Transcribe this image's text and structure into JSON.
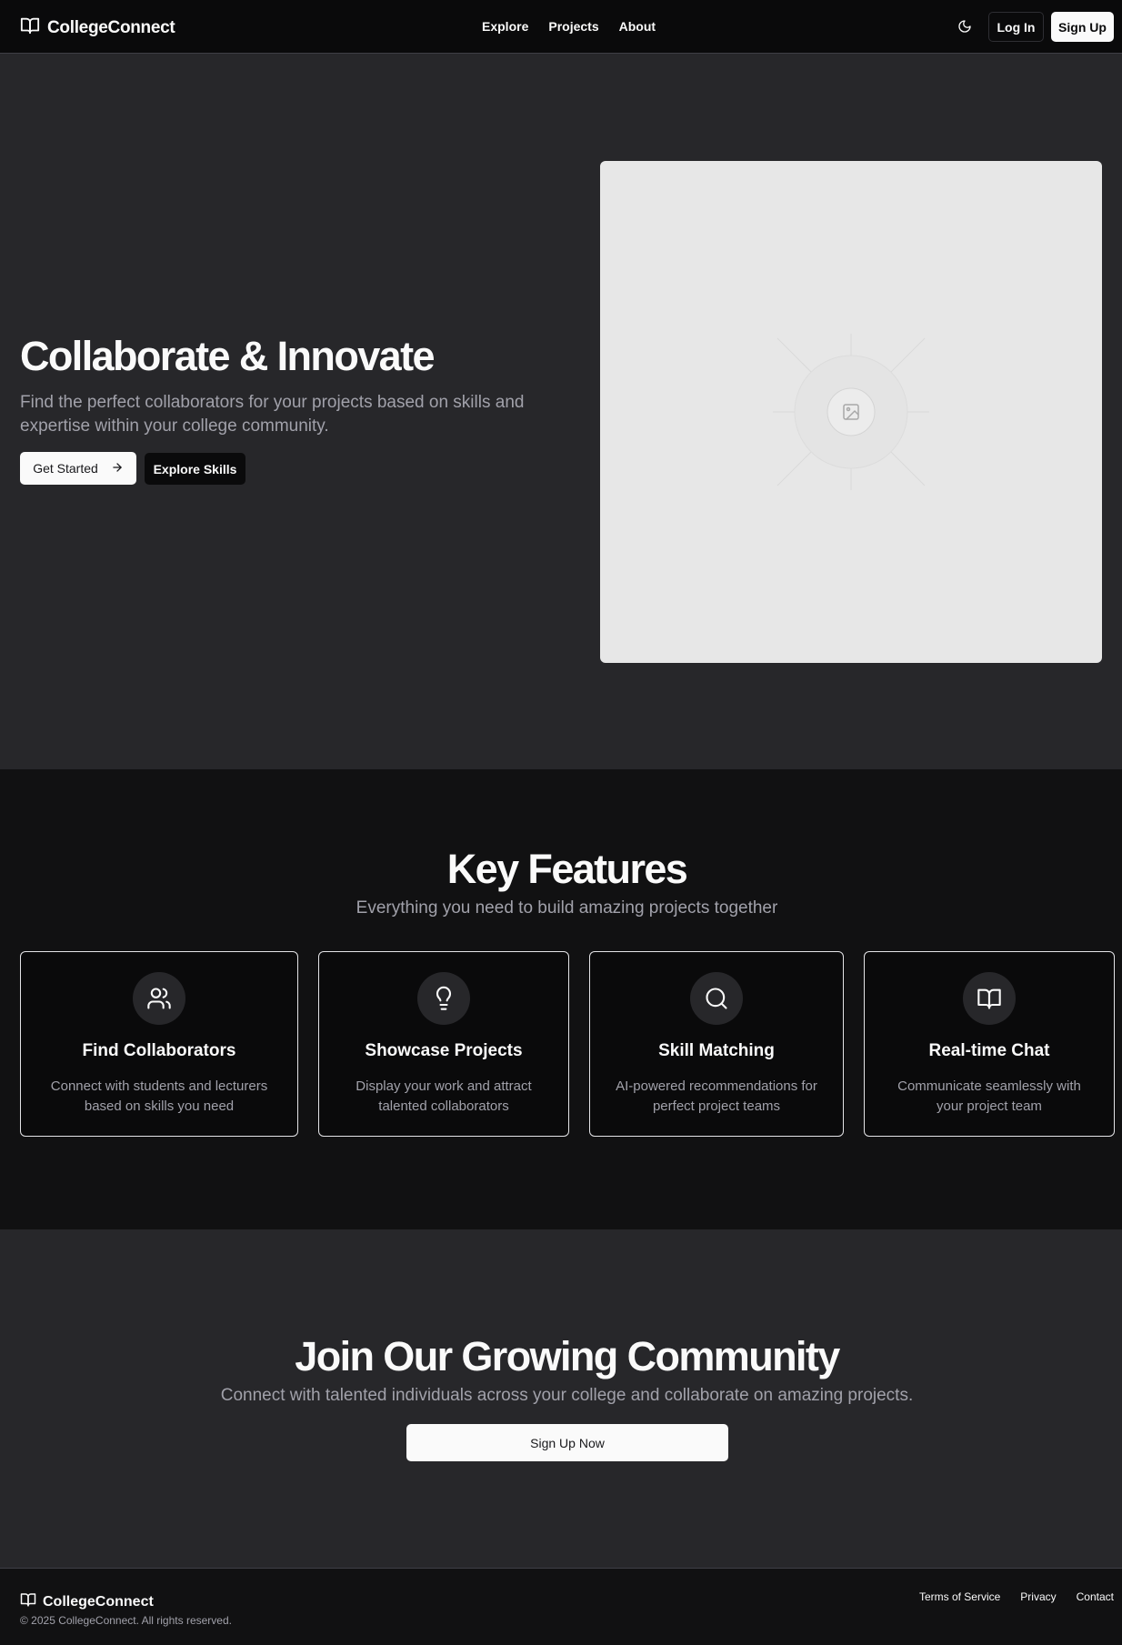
{
  "nav": {
    "brand": "CollegeConnect",
    "links": [
      "Explore",
      "Projects",
      "About"
    ],
    "login": "Log In",
    "signup": "Sign Up"
  },
  "hero": {
    "title": "Collaborate & Innovate",
    "subtitle": "Find the perfect collaborators for your projects based on skills and expertise within your college community.",
    "get_started": "Get Started",
    "explore_skills": "Explore Skills"
  },
  "features": {
    "title": "Key Features",
    "subtitle": "Everything you need to build amazing projects together",
    "cards": [
      {
        "icon": "users-icon",
        "title": "Find Collaborators",
        "desc": "Connect with students and lecturers based on skills you need"
      },
      {
        "icon": "lightbulb-icon",
        "title": "Showcase Projects",
        "desc": "Display your work and attract talented collaborators"
      },
      {
        "icon": "search-icon",
        "title": "Skill Matching",
        "desc": "AI-powered recommendations for perfect project teams"
      },
      {
        "icon": "book-open-icon",
        "title": "Real-time Chat",
        "desc": "Communicate seamlessly with your project team"
      }
    ]
  },
  "community": {
    "title": "Join Our Growing Community",
    "subtitle": "Connect with talented individuals across your college and collaborate on amazing projects.",
    "cta": "Sign Up Now"
  },
  "footer": {
    "brand": "CollegeConnect",
    "copyright": "© 2025 CollegeConnect. All rights reserved.",
    "links": [
      "Terms of Service",
      "Privacy",
      "Contact"
    ]
  },
  "colors": {
    "page_bg": "#27272a",
    "nav_bg": "#0a0a0b",
    "section_dark": "#111112",
    "text": "#fafafa",
    "muted": "#a1a1aa",
    "placeholder_bg": "#e7e7e7"
  }
}
